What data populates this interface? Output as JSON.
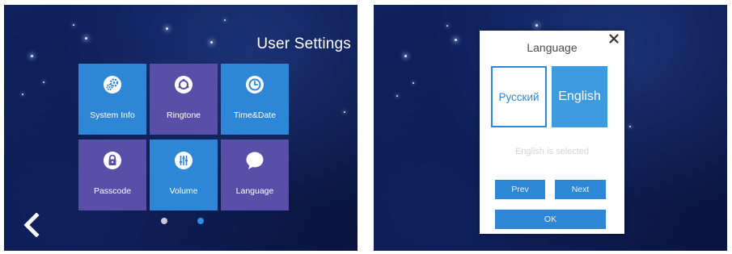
{
  "left_screen": {
    "title": "User Settings",
    "tiles": [
      {
        "label": "System Info",
        "icon": "gears-icon",
        "color": "#2e86d6"
      },
      {
        "label": "Ringtone",
        "icon": "ringtone-icon",
        "color": "#5a4fa8"
      },
      {
        "label": "Time&Date",
        "icon": "clock-icon",
        "color": "#2e86d6"
      },
      {
        "label": "Passcode",
        "icon": "lock-icon",
        "color": "#5a4fa8"
      },
      {
        "label": "Volume",
        "icon": "volume-sliders-icon",
        "color": "#2e86d6"
      },
      {
        "label": "Language",
        "icon": "speech-bubble-icon",
        "color": "#5a4fa8"
      }
    ],
    "back_icon": "chevron-left-icon",
    "pager": {
      "pages": 2,
      "current": 2,
      "inactive_color": "#c8ccd6",
      "active_color": "#2e8fe8"
    }
  },
  "right_screen": {
    "dialog": {
      "title": "Language",
      "close_icon": "close-icon",
      "options": [
        {
          "label": "Русский",
          "selected": false
        },
        {
          "label": "English",
          "selected": true
        }
      ],
      "status": "English is selected",
      "prev_label": "Prev",
      "next_label": "Next",
      "ok_label": "OK"
    }
  },
  "colors": {
    "background": "#0b1b4f",
    "tile_blue": "#2e86d6",
    "tile_purple": "#5a4fa8",
    "dialog_bg": "#ffffff",
    "button_blue": "#2e86d6"
  }
}
